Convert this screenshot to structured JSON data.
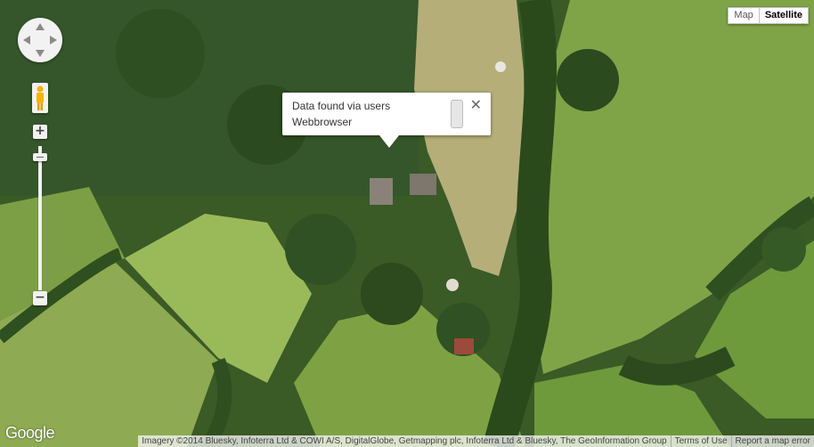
{
  "map": {
    "type_control": {
      "map_label": "Map",
      "satellite_label": "Satellite",
      "active": "Satellite"
    },
    "zoom": {
      "plus_label": "+",
      "minus_label": "−"
    },
    "infowindow": {
      "text": "Data found via users Webbrowser",
      "close_label": "✕"
    },
    "logo_text": "Google",
    "attribution": {
      "imagery": "Imagery ©2014 Bluesky, Infoterra Ltd & COWI A/S, DigitalGlobe, Getmapping plc, Infoterra Ltd & Bluesky, The GeoInformation Group",
      "terms": "Terms of Use",
      "report": "Report a map error"
    },
    "colors": {
      "field_light": "#8fb04e",
      "field_mid": "#6f9a3a",
      "trees_dark": "#2c4a1d",
      "harvested_field": "#b8b07a"
    },
    "icons": [
      "pan-control-icon",
      "pegman-icon",
      "close-icon"
    ]
  }
}
